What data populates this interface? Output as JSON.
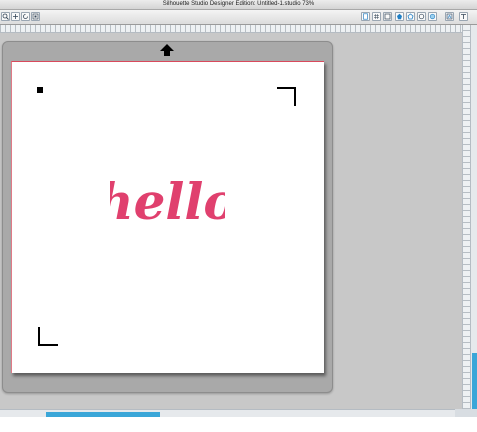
{
  "window": {
    "title": "Silhouette Studio Designer Edition: Untitled-1.studio 73%"
  },
  "toolbar": {
    "left_tools": [
      "zoom-icon",
      "pan-icon",
      "rotate-icon",
      "fit-icon"
    ],
    "right_tools": [
      "page-setup-icon",
      "grid-icon",
      "cut-settings-icon",
      "fill-color-icon",
      "line-color-icon",
      "line-style-icon",
      "image-effects-icon",
      "trace-icon",
      "text-style-icon"
    ]
  },
  "canvas": {
    "artwork_text": "hello",
    "artwork_color": "#e0406e",
    "mat_color": "#a9a9a9",
    "page_border_color": "#d94a5c"
  },
  "scrollbars": {
    "accent_color": "#3aa6d8"
  }
}
